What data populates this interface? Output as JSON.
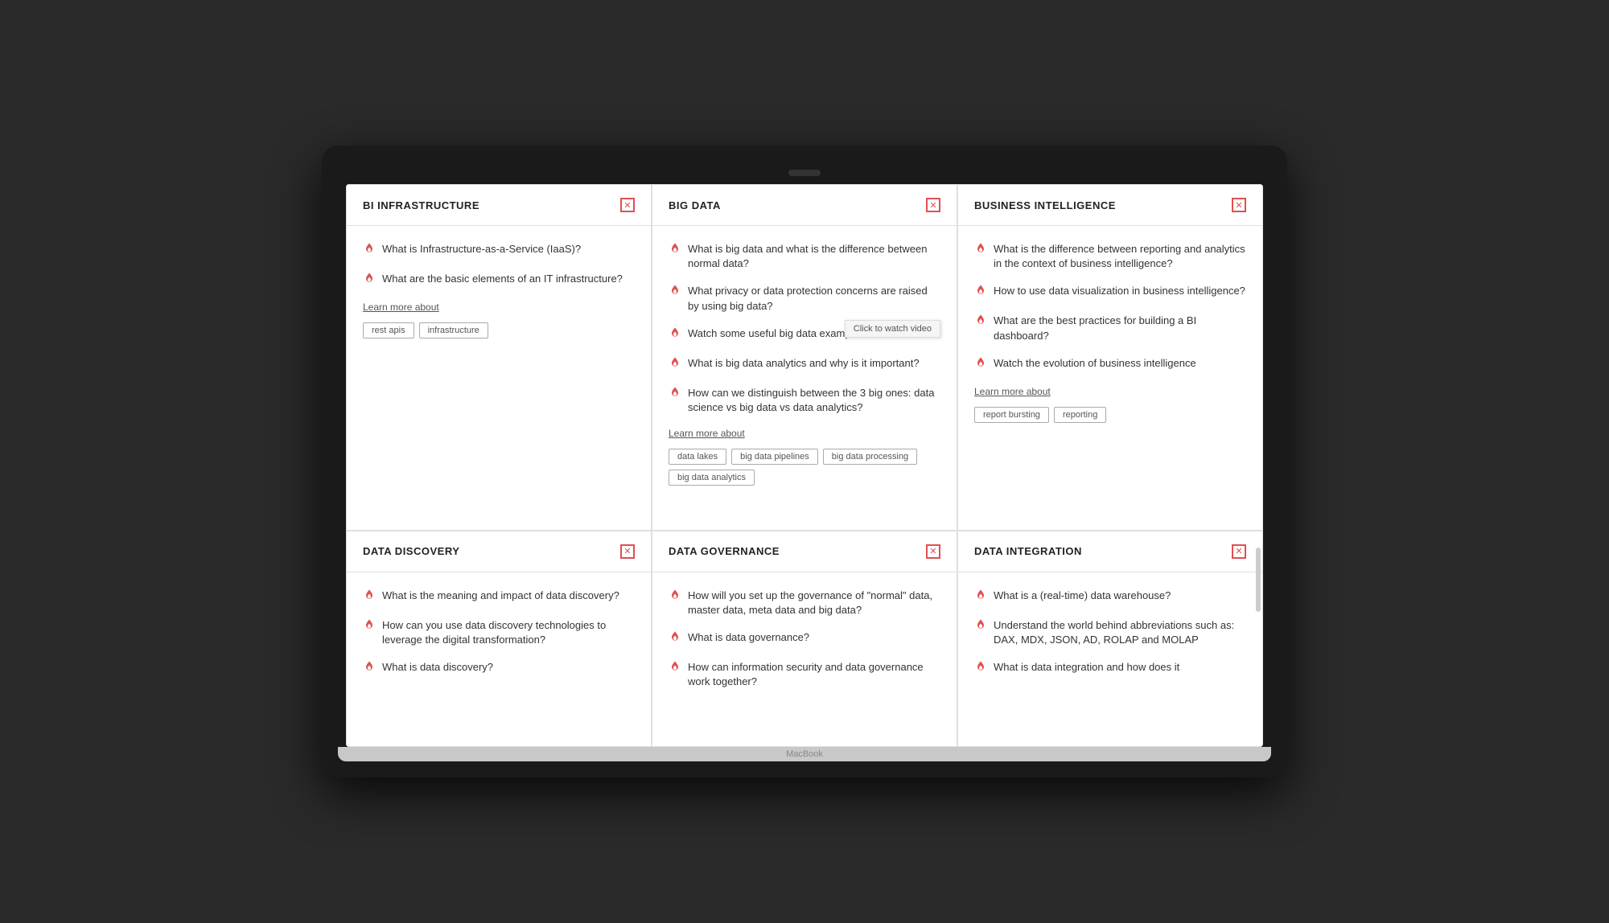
{
  "panels": [
    {
      "id": "bi-infrastructure",
      "title": "BI INFRASTRUCTURE",
      "questions": [
        "What is Infrastructure-as-a-Service (IaaS)?",
        "What are the basic elements of an IT infrastructure?"
      ],
      "learnMore": "Learn more about",
      "tags": [
        "rest apis",
        "infrastructure"
      ],
      "tooltip": null
    },
    {
      "id": "big-data",
      "title": "BIG DATA",
      "questions": [
        "What is big data and what is the difference between normal data?",
        "What privacy or data protection concerns are raised by using big data?",
        "Watch some useful big data examples from real-life",
        "What is big data analytics and why is it important?",
        "How can we distinguish between the 3 big ones: data science vs big data vs data analytics?"
      ],
      "learnMore": "Learn more about",
      "tags": [
        "data lakes",
        "big data pipelines",
        "big data processing",
        "big data analytics"
      ],
      "tooltip": "Click to watch video"
    },
    {
      "id": "business-intelligence",
      "title": "BUSINESS INTELLIGENCE",
      "questions": [
        "What is the difference between reporting and analytics in the context of business intelligence?",
        "How to use data visualization in business intelligence?",
        "What are the best practices for building a BI dashboard?",
        "Watch the evolution of business intelligence"
      ],
      "learnMore": "Learn more about",
      "tags": [
        "report bursting",
        "reporting"
      ],
      "tooltip": null
    },
    {
      "id": "data-discovery",
      "title": "DATA DISCOVERY",
      "questions": [
        "What is the meaning and impact of data discovery?",
        "How can you use data discovery technologies to leverage the digital transformation?",
        "What is data discovery?"
      ],
      "learnMore": null,
      "tags": [],
      "tooltip": null
    },
    {
      "id": "data-governance",
      "title": "DATA GOVERNANCE",
      "questions": [
        "How will you set up the governance of \"normal\" data, master data, meta data and big data?",
        "What is data governance?",
        "How can information security and data governance work together?"
      ],
      "learnMore": null,
      "tags": [],
      "tooltip": null
    },
    {
      "id": "data-integration",
      "title": "DATA INTEGRATION",
      "questions": [
        "What is a (real-time) data warehouse?",
        "Understand the world behind abbreviations such as: DAX, MDX, JSON, AD, ROLAP and MOLAP",
        "What is data integration and how does it"
      ],
      "learnMore": null,
      "tags": [],
      "tooltip": null,
      "hasScrollbar": true
    }
  ],
  "laptop": {
    "brand": "MacBook"
  },
  "icons": {
    "close": "✕",
    "fire": "🔥"
  }
}
